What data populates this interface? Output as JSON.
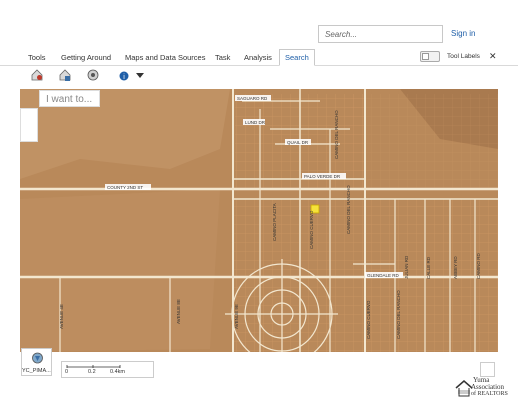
{
  "header": {
    "search_placeholder": "Search...",
    "signin_label": "Sign in"
  },
  "tabs": [
    {
      "label": "Tools"
    },
    {
      "label": "Getting Around"
    },
    {
      "label": "Maps and Data Sources"
    },
    {
      "label": "Task"
    },
    {
      "label": "Analysis"
    },
    {
      "label": "Search",
      "active": true
    }
  ],
  "toolbar": {
    "tool_labels_label": "Tool Labels",
    "close_label": "✕",
    "icons": [
      "property-search-icon",
      "layers-icon",
      "measure-icon",
      "identify-icon",
      "dropdown-arrow-icon"
    ]
  },
  "map": {
    "prompt_placeholder": "I want to...",
    "road_labels": {
      "saguaro": "SAGUARO RD",
      "lund": "LUND DR",
      "quail": "QUAIL DR",
      "paloverde": "PALO VERDE DR",
      "county": "COUNTY 2ND ST",
      "glendale": "GLENDALE RD",
      "camino_1": "CAMINO PLACITA",
      "camino_2": "CAMINO CUERVO",
      "camino_3": "CAMINO DEL RANCHO",
      "camino_4": "CAMINO DEL RANCHO",
      "avenue_a": "AVENUE 4E",
      "avenue_b": "AVENUE 8E",
      "avenue_c": "AVENUE 9E",
      "right_1": "JULIAN RD",
      "right_2": "CALLE RD",
      "right_3": "ABBEY RD",
      "right_4": "CAMINO RD"
    },
    "colors": {
      "terrain": "#b9895a",
      "road": "#f3e7cf",
      "parcel": "#d9a06b",
      "highlight": "#f5e23a"
    }
  },
  "bottom": {
    "basemap_label": "YC_PIMA...",
    "scale_labels": [
      "0",
      "0.2",
      "0.4km"
    ]
  },
  "logo": {
    "line1": "Yuma",
    "line2": "Association",
    "line3": "of REALTORS"
  }
}
